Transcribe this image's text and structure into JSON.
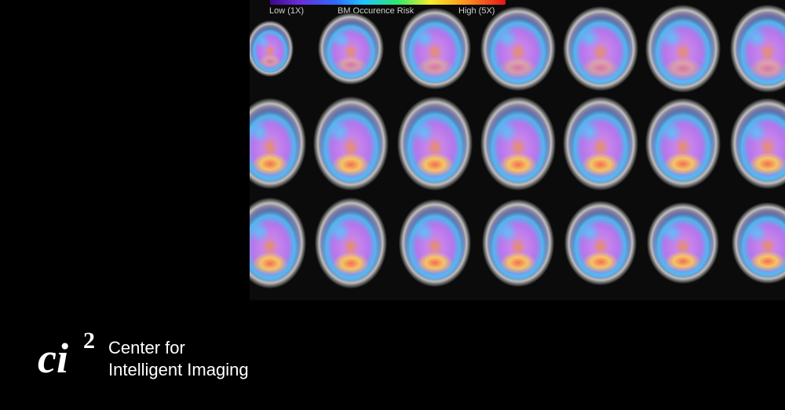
{
  "figure": {
    "scale_low_label": "Low (1X)",
    "scale_title": "BM Occurence Risk",
    "scale_high_label": "High (5X)",
    "colorbar_colors": [
      "#3b0a8a",
      "#6a2bd6",
      "#2f6bff",
      "#20c6ff",
      "#2ee86b",
      "#f5f02a",
      "#ff9a1e",
      "#e3161a"
    ]
  },
  "logo": {
    "mark_letters": "ci",
    "mark_superscript": "2",
    "line1": "Center for",
    "line2": "Intelligent Imaging"
  },
  "colors": {
    "background": "#000000",
    "text": "#ffffff"
  }
}
